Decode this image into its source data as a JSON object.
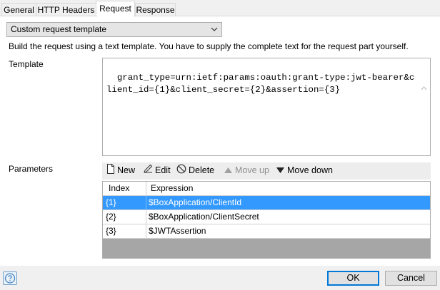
{
  "tabs": [
    {
      "label": "General"
    },
    {
      "label": "HTTP Headers"
    },
    {
      "label": "Request",
      "active": true
    },
    {
      "label": "Response"
    }
  ],
  "request": {
    "mode_selected": "Custom request template",
    "description": "Build the request using a text template. You have to supply the complete text for the request part yourself.",
    "template_label": "Template",
    "template_text": "grant_type=urn:ietf:params:oauth:grant-type:jwt-bearer&client_id={1}&client_secret={2}&assertion={3}",
    "parameters_label": "Parameters"
  },
  "toolbar": {
    "new_label": "New",
    "edit_label": "Edit",
    "delete_label": "Delete",
    "move_up_label": "Move up",
    "move_down_label": "Move down"
  },
  "parameters_table": {
    "columns": [
      "Index",
      "Expression"
    ],
    "rows": [
      {
        "index": "{1}",
        "expression": "$BoxApplication/ClientId",
        "selected": true
      },
      {
        "index": "{2}",
        "expression": "$BoxApplication/ClientSecret"
      },
      {
        "index": "{3}",
        "expression": "$JWTAssertion"
      }
    ]
  },
  "footer": {
    "help_icon": "help-icon",
    "ok_label": "OK",
    "cancel_label": "Cancel"
  },
  "colors": {
    "selection": "#3399ff",
    "primary_border": "#0078d7",
    "panel": "#ffffff",
    "chrome": "#f0f0f0"
  }
}
